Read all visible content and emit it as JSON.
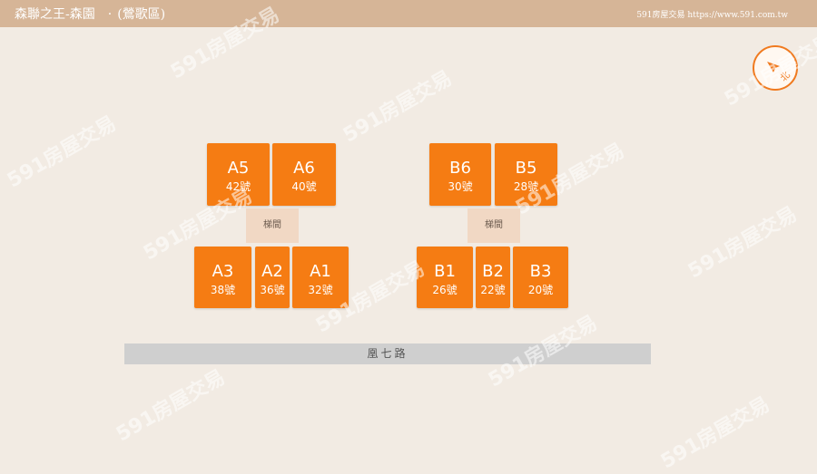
{
  "header": {
    "title": "森聯之王-森園",
    "separator": "·",
    "district": "(鶯歌區)",
    "site": "591房屋交易 https://www.591.com.tw"
  },
  "compass": {
    "label": "北",
    "icon": "north-arrow-icon"
  },
  "building_a": {
    "units": [
      {
        "code": "A5",
        "number": "42號"
      },
      {
        "code": "A6",
        "number": "40號"
      },
      {
        "code": "A3",
        "number": "38號"
      },
      {
        "code": "A2",
        "number": "36號"
      },
      {
        "code": "A1",
        "number": "32號"
      }
    ],
    "stair": "梯間"
  },
  "building_b": {
    "units": [
      {
        "code": "B6",
        "number": "30號"
      },
      {
        "code": "B5",
        "number": "28號"
      },
      {
        "code": "B1",
        "number": "26號"
      },
      {
        "code": "B2",
        "number": "22號"
      },
      {
        "code": "B3",
        "number": "20號"
      }
    ],
    "stair": "梯間"
  },
  "road": "凰七路",
  "watermark": "591房屋交易",
  "colors": {
    "unit": "#f57c13",
    "header": "#d6b597",
    "stair": "#f1d8c4",
    "road": "#cfcfcf",
    "background": "#f2ebe3"
  }
}
